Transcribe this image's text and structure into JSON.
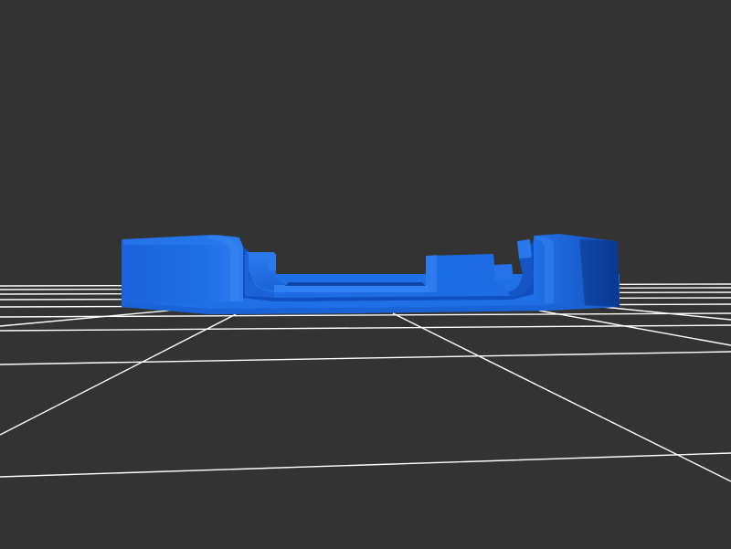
{
  "scene": {
    "background_color": "#333333",
    "grid_color": "#ffffff",
    "model_color": "#1f6fe6",
    "model_shadow_color": "#0b3f9e",
    "model_highlight_color": "#3a86f2"
  }
}
